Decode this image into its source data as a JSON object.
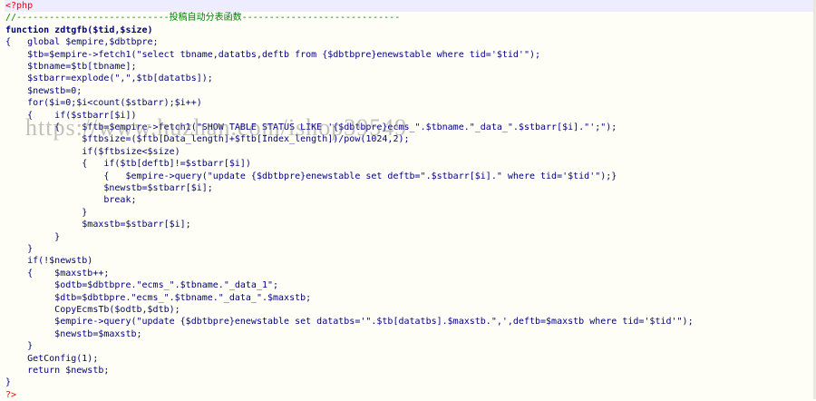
{
  "editor": {
    "language": "php",
    "lines": [
      {
        "text": "<?php",
        "cls": "tag"
      },
      {
        "text": "//----------------------------投稿自动分表函数-----------------------------",
        "cls": "cmt"
      },
      {
        "text": "function zdtgfb($tid,$size)",
        "cls": "kw"
      },
      {
        "text": "{   global $empire,$dbtbpre;",
        "cls": "var"
      },
      {
        "text": "    $tb=$empire->fetch1(\"select tbname,datatbs,deftb from {$dbtbpre}enewstable where tid='$tid'\");",
        "cls": "var"
      },
      {
        "text": "    $tbname=$tb[tbname];",
        "cls": "var"
      },
      {
        "text": "    $stbarr=explode(\",\",$tb[datatbs]);",
        "cls": "var"
      },
      {
        "text": "    $newstb=0;",
        "cls": "var"
      },
      {
        "text": "    for($i=0;$i<count($stbarr);$i++)",
        "cls": "var"
      },
      {
        "text": "    {    if($stbarr[$i])",
        "cls": "var"
      },
      {
        "text": "         {    $ftb=$empire->fetch1(\"SHOW TABLE STATUS LIKE '{$dbtbpre}ecms_\".$tbname.\"_data_\".$stbarr[$i].\"';\");",
        "cls": "var"
      },
      {
        "text": "              $ftbsize=($ftb[Data_length]+$ftb[Index_length])/pow(1024,2);",
        "cls": "var"
      },
      {
        "text": "              if($ftbsize<$size)",
        "cls": "var"
      },
      {
        "text": "              {   if($tb[deftb]!=$stbarr[$i])",
        "cls": "var"
      },
      {
        "text": "                  {   $empire->query(\"update {$dbtbpre}enewstable set deftb=\".$stbarr[$i].\" where tid='$tid'\");}",
        "cls": "var"
      },
      {
        "text": "                  $newstb=$stbarr[$i];",
        "cls": "var"
      },
      {
        "text": "                  break;",
        "cls": "var"
      },
      {
        "text": "              }",
        "cls": "var"
      },
      {
        "text": "              $maxstb=$stbarr[$i];",
        "cls": "var"
      },
      {
        "text": "         }",
        "cls": "var"
      },
      {
        "text": "    }",
        "cls": "var"
      },
      {
        "text": "    if(!$newstb)",
        "cls": "var"
      },
      {
        "text": "    {    $maxstb++;",
        "cls": "var"
      },
      {
        "text": "         $odtb=$dbtbpre.\"ecms_\".$tbname.\"_data_1\";",
        "cls": "var"
      },
      {
        "text": "         $dtb=$dbtbpre.\"ecms_\".$tbname.\"_data_\".$maxstb;",
        "cls": "var"
      },
      {
        "text": "         CopyEcmsTb($odtb,$dtb);",
        "cls": "var"
      },
      {
        "text": "         $empire->query(\"update {$dbtbpre}enewstable set datatbs='\".$tb[datatbs].$maxstb.\",',deftb=$maxstb where tid='$tid'\");",
        "cls": "var"
      },
      {
        "text": "         $newstb=$maxstb;",
        "cls": "var"
      },
      {
        "text": "    }",
        "cls": "var"
      },
      {
        "text": "    GetConfig(1);",
        "cls": "var"
      },
      {
        "text": "    return $newstb;",
        "cls": "var"
      },
      {
        "text": "}",
        "cls": "var"
      },
      {
        "text": "?>",
        "cls": "tag"
      }
    ]
  },
  "watermark": "https://www.huzhan.com/ishop39549"
}
